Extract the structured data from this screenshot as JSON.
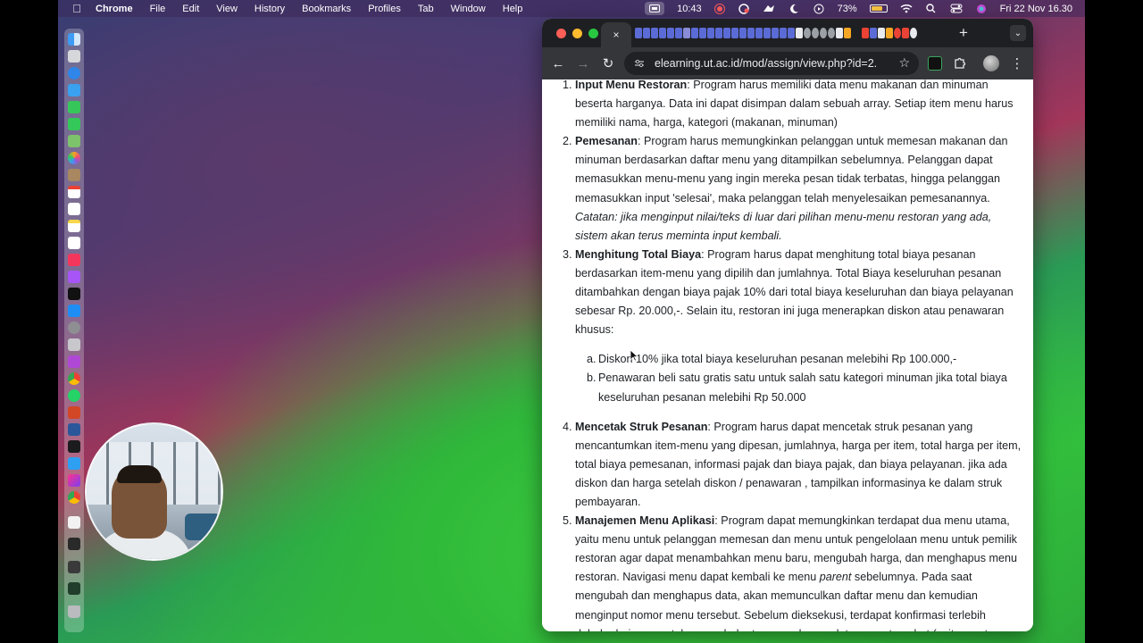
{
  "menubar": {
    "app_name": "Chrome",
    "menus": [
      "File",
      "Edit",
      "View",
      "History",
      "Bookmarks",
      "Profiles",
      "Tab",
      "Window",
      "Help"
    ],
    "time_recording": "10:43",
    "battery_percent": "73%",
    "datetime": "Fri 22 Nov  16.30"
  },
  "browser": {
    "active_tab_close": "×",
    "new_tab": "+",
    "tab_list": "⌄",
    "url": "elearning.ut.ac.id/mod/assign/view.php?id=2...",
    "back": "←",
    "forward": "→",
    "reload": "↻",
    "bookmark": "☆",
    "menu": "⋮"
  },
  "content": {
    "items": [
      {
        "num": "1.",
        "title": "Input Menu Restoran",
        "text": ": Program harus memiliki data menu makanan dan minuman beserta harganya. Data ini dapat disimpan dalam sebuah array. Setiap item menu harus memiliki nama, harga, kategori (makanan, minuman)"
      },
      {
        "num": "2.",
        "title": "Pemesanan",
        "text": ": Program harus memungkinkan pelanggan untuk memesan makanan dan minuman berdasarkan daftar menu yang ditampilkan sebelumnya. Pelanggan dapat memasukkan menu-menu yang ingin mereka pesan tidak terbatas, hingga pelanggan memasukkan input 'selesai', maka pelanggan telah menyelesaikan pemesanannya.",
        "note": "Catatan: jika menginput nilai/teks di luar dari pilihan menu-menu restoran yang ada, sistem akan terus meminta input kembali."
      },
      {
        "num": "3.",
        "title": "Menghitung Total Biaya",
        "text": ": Program harus dapat menghitung total biaya pesanan berdasarkan item-menu yang dipilih dan jumlahnya. Total Biaya keseluruhan pesanan ditambahkan dengan biaya pajak 10% dari total biaya keseluruhan dan biaya pelayanan sebesar Rp. 20.000,-. Selain itu, restoran ini juga menerapkan diskon atau penawaran khusus:",
        "subitems": [
          {
            "num": "a.",
            "text": "Diskon 10% jika total biaya keseluruhan pesanan melebihi Rp 100.000,-"
          },
          {
            "num": "b.",
            "text": "Penawaran beli satu gratis satu untuk salah satu kategori minuman jika total biaya keseluruhan pesanan melebihi Rp 50.000"
          }
        ]
      },
      {
        "num": "4.",
        "title": "Mencetak Struk Pesanan",
        "text": ": Program harus dapat mencetak struk pesanan yang mencantumkan item-menu yang dipesan, jumlahnya, harga per item, total harga per item, total biaya pemesanan, informasi pajak dan biaya pajak, dan biaya pelayanan. jika ada diskon dan harga setelah diskon / penawaran , tampilkan informasinya ke dalam struk pembayaran."
      },
      {
        "num": "5.",
        "title": "Manajemen Menu Aplikasi",
        "text_a": ": Program dapat memungkinkan terdapat dua menu utama, yaitu menu untuk pelanggan memesan dan menu untuk pengelolaan menu untuk pemilik restoran agar dapat menambahkan menu baru, mengubah harga, dan menghapus menu restoran. Navigasi menu dapat kembali ke menu ",
        "italic": "parent",
        "text_b": " sebelumnya. Pada saat mengubah dan menghapus data, akan memunculkan daftar menu dan kemudian menginput nomor menu tersebut. Sebelum dieksekusi, terdapat konfirmasi terlebih dahulu dari user untuk mengubah atau menghapus data menu tersebut (yaitu ya atau tidak)."
      }
    ]
  }
}
